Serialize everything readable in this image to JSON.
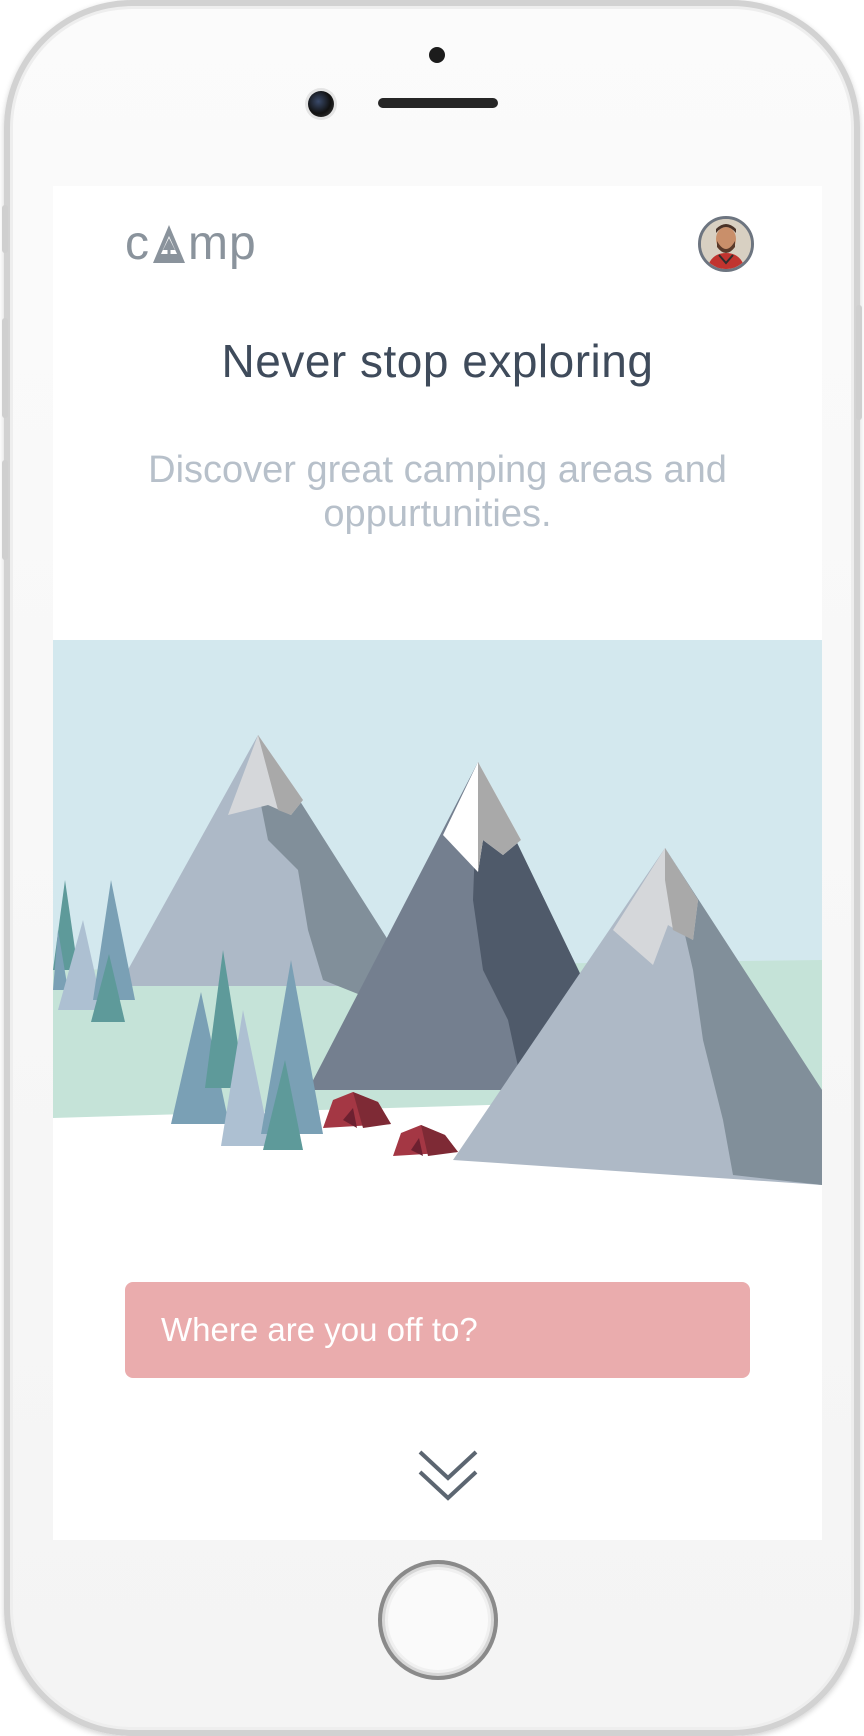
{
  "app": {
    "logo_letters": [
      "c",
      "mp"
    ],
    "logo_icon": "tree-a-icon",
    "avatar_icon": "user-avatar"
  },
  "hero": {
    "headline": "Never stop exploring",
    "subline": "Discover great camping areas and oppurtunities."
  },
  "search": {
    "label": "Where are you off to?"
  },
  "scroll": {
    "icon": "double-chevron-down-icon"
  },
  "colors": {
    "accent": "#eaacad",
    "headline": "#3f4b5b",
    "subline": "#b7c0ca",
    "sky": "#d3e8ee",
    "meadow": "#c5e3d8",
    "tent": "#a43744"
  }
}
